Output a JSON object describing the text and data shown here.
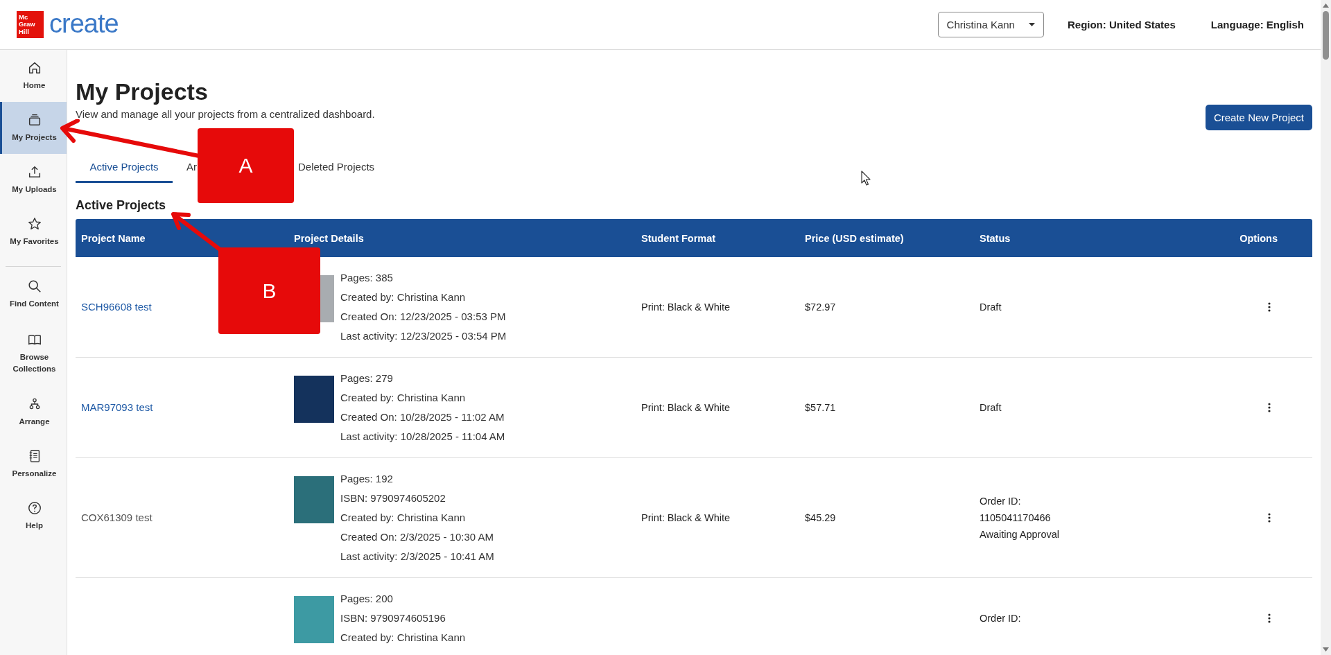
{
  "header": {
    "logo_badge_lines": [
      "Mc",
      "Graw",
      "Hill"
    ],
    "logo_wordmark": "create",
    "user_menu": "Christina Kann",
    "region": "Region: United States",
    "language": "Language: English"
  },
  "sidebar": {
    "sections": [
      [
        {
          "label": "Home",
          "selected": false
        },
        {
          "label": "My Projects",
          "selected": true
        },
        {
          "label": "My Uploads",
          "selected": false
        },
        {
          "label": "My Favorites",
          "selected": false
        }
      ],
      [
        {
          "label": "Find Content",
          "selected": false
        },
        {
          "label": "Browse Collections",
          "selected": false
        },
        {
          "label": "Arrange",
          "selected": false
        },
        {
          "label": "Personalize",
          "selected": false
        },
        {
          "label": "Help",
          "selected": false
        }
      ]
    ]
  },
  "page": {
    "title": "My Projects",
    "subtitle": "View and manage all your projects from a centralized dashboard.",
    "create_button": "Create New Project"
  },
  "tabs": [
    {
      "label": "Active Projects",
      "selected": true
    },
    {
      "label": "Ar",
      "selected": false
    },
    {
      "label": "Deleted Projects",
      "selected": false
    }
  ],
  "section_title": "Active Projects",
  "table": {
    "columns": [
      "Project Name",
      "Project Details",
      "Student Format",
      "Price (USD estimate)",
      "Status",
      "Options"
    ],
    "rows": [
      {
        "name": "SCH96608 test",
        "linked": true,
        "details": [
          "Pages: 385",
          "Created by: Christina Kann",
          "Created On: 12/23/2025 - 03:53 PM",
          "Last activity: 12/23/2025 - 03:54 PM"
        ],
        "format": "Print: Black & White",
        "price": "$72.97",
        "status": [
          "Draft"
        ]
      },
      {
        "name": "MAR97093 test",
        "linked": true,
        "details": [
          "Pages: 279",
          "Created by: Christina Kann",
          "Created On: 10/28/2025 - 11:02 AM",
          "Last activity: 10/28/2025 - 11:04 AM"
        ],
        "format": "Print: Black & White",
        "price": "$57.71",
        "status": [
          "Draft"
        ]
      },
      {
        "name": "COX61309 test",
        "linked": false,
        "details": [
          "Pages: 192",
          "ISBN: 9790974605202",
          "Created by: Christina Kann",
          "Created On: 2/3/2025 - 10:30 AM",
          "Last activity: 2/3/2025 - 10:41 AM"
        ],
        "format": "Print: Black & White",
        "price": "$45.29",
        "status": [
          "Order ID:",
          "1105041170466",
          "Awaiting Approval"
        ]
      },
      {
        "details": [
          "Pages: 200",
          "ISBN: 9790974605196",
          "Created by: Christina Kann"
        ],
        "status": [
          "Order ID:"
        ]
      }
    ]
  },
  "annotations": [
    {
      "label": "A"
    },
    {
      "label": "B"
    }
  ]
}
